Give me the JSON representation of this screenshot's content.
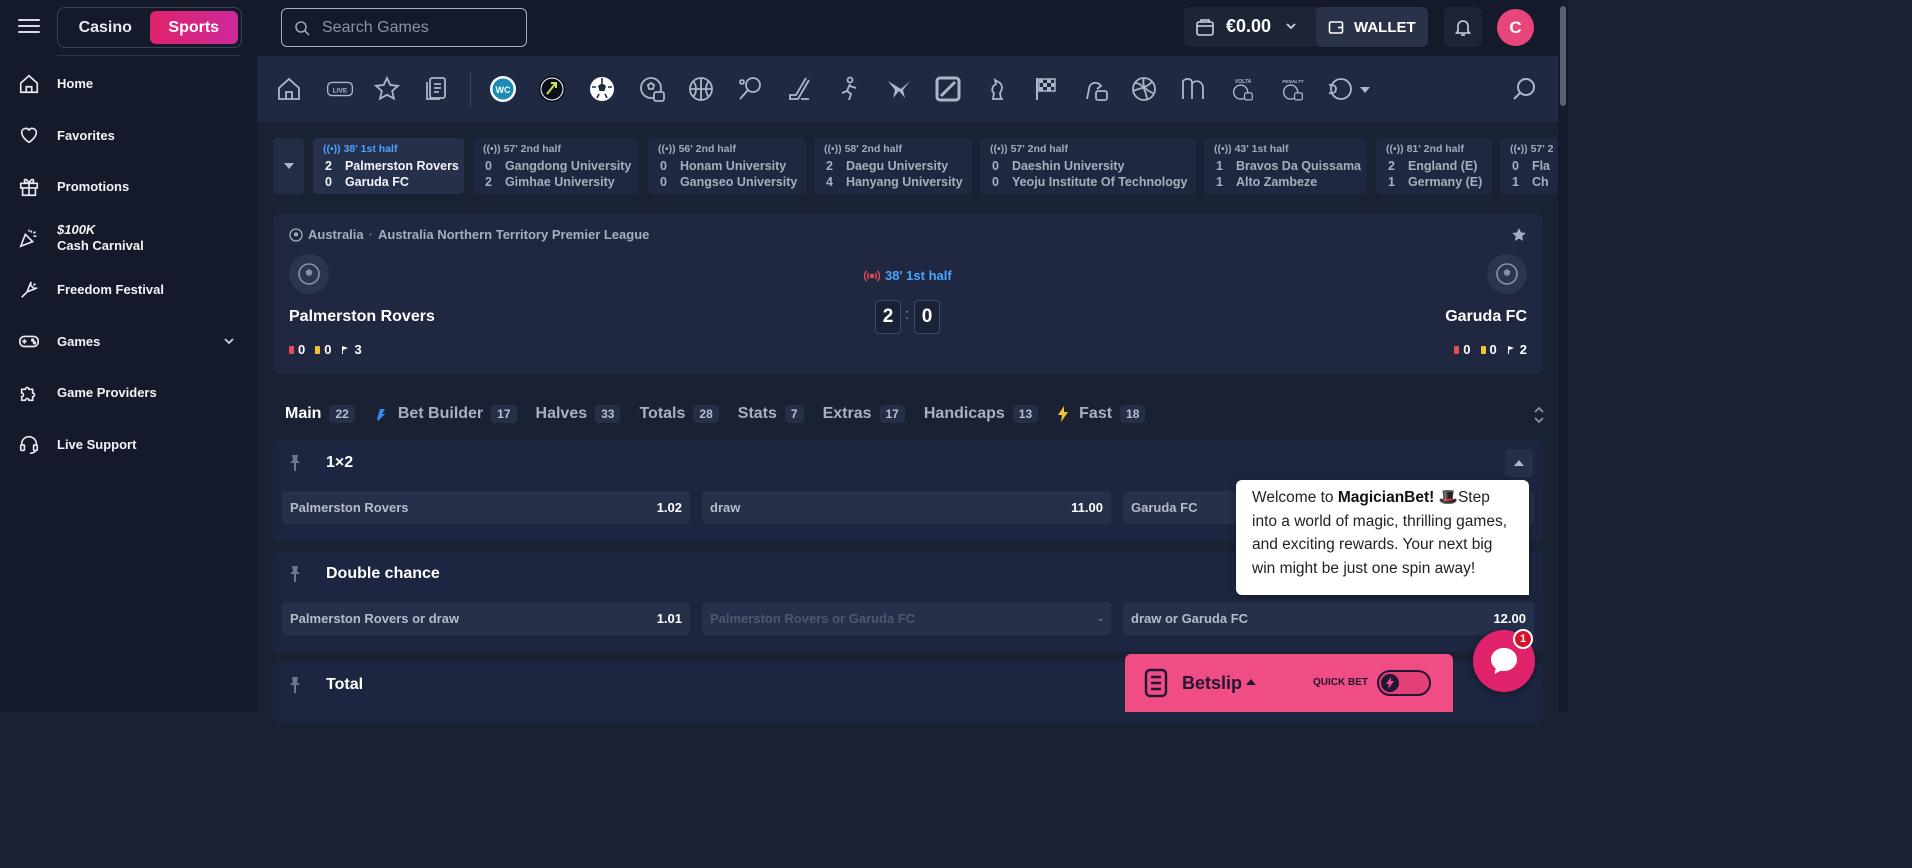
{
  "sidebar": {
    "toggle": {
      "casino": "Casino",
      "sports": "Sports"
    },
    "items": [
      {
        "label": "Home",
        "icon": "home-icon"
      },
      {
        "label": "Favorites",
        "icon": "heart-icon"
      },
      {
        "label": "Promotions",
        "icon": "gift-icon"
      },
      {
        "label_top": "$100K",
        "label": "Cash Carnival",
        "icon": "confetti-icon"
      },
      {
        "label": "Freedom Festival",
        "icon": "fireworks-icon"
      },
      {
        "label": "Games",
        "icon": "gamepad-icon"
      },
      {
        "label": "Game Providers",
        "icon": "puzzle-icon"
      },
      {
        "label": "Live Support",
        "icon": "headset-icon"
      }
    ]
  },
  "topbar": {
    "search_placeholder": "Search Games",
    "balance": "€0.00",
    "wallet_label": "WALLET",
    "avatar_letter": "C"
  },
  "sports_icons": [
    "home-icon",
    "live-icon",
    "star-icon",
    "betslip-history-icon",
    "world-cup-icon",
    "tennis-badge-icon",
    "soccer-icon",
    "efootball-icon",
    "basketball-icon",
    "tennis-icon",
    "ice-hockey-icon",
    "cricket-icon",
    "volleyball-icon",
    "table-tennis-icon",
    "chess-icon",
    "racing-flag-icon",
    "esports-icon",
    "volleyball-icon",
    "handball-icon",
    "volta-icon",
    "penalty-icon",
    "more-sports-icon",
    "search-icon"
  ],
  "sports_labels": {
    "volta": "VOLTA",
    "penalty": "PENALTY"
  },
  "live_matches": [
    {
      "time": "38' 1st half",
      "home": "Palmerston Rovers",
      "away": "Garuda FC",
      "hs": "2",
      "as": "0",
      "active": true
    },
    {
      "time": "57' 2nd half",
      "home": "Gangdong University",
      "away": "Gimhae University",
      "hs": "0",
      "as": "2"
    },
    {
      "time": "56' 2nd half",
      "home": "Honam University",
      "away": "Gangseo University",
      "hs": "0",
      "as": "0"
    },
    {
      "time": "58' 2nd half",
      "home": "Daegu University",
      "away": "Hanyang University",
      "hs": "2",
      "as": "4"
    },
    {
      "time": "57' 2nd half",
      "home": "Daeshin University",
      "away": "Yeoju Institute Of Technology",
      "hs": "0",
      "as": "0"
    },
    {
      "time": "43' 1st half",
      "home": "Bravos Da Quissama",
      "away": "Alto Zambeze",
      "hs": "1",
      "as": "1"
    },
    {
      "time": "81' 2nd half",
      "home": "England (E)",
      "away": "Germany (E)",
      "hs": "2",
      "as": "1"
    },
    {
      "time": "57' 2",
      "home": "Fla",
      "away": "Ch",
      "hs": "0",
      "as": "1"
    }
  ],
  "match": {
    "country": "Australia",
    "league": "Australia Northern Territory Premier League",
    "status": "38' 1st half",
    "home": "Palmerston Rovers",
    "away": "Garuda FC",
    "home_score": "2",
    "away_score": "0",
    "colon": ":",
    "home_stats": {
      "red": "0",
      "yellow": "0",
      "corners": "3"
    },
    "away_stats": {
      "red": "0",
      "yellow": "0",
      "corners": "2"
    }
  },
  "tabs": [
    {
      "label": "Main",
      "count": "22"
    },
    {
      "label": "Bet Builder",
      "count": "17"
    },
    {
      "label": "Halves",
      "count": "33"
    },
    {
      "label": "Totals",
      "count": "28"
    },
    {
      "label": "Stats",
      "count": "7"
    },
    {
      "label": "Extras",
      "count": "17"
    },
    {
      "label": "Handicaps",
      "count": "13"
    },
    {
      "label": "Fast",
      "count": "18"
    }
  ],
  "markets": [
    {
      "title": "1×2",
      "odds": [
        {
          "label": "Palmerston Rovers",
          "value": "1.02"
        },
        {
          "label": "draw",
          "value": "11.00"
        },
        {
          "label": "Garuda FC",
          "value": ""
        }
      ]
    },
    {
      "title": "Double chance",
      "odds": [
        {
          "label": "Palmerston Rovers or draw",
          "value": "1.01"
        },
        {
          "label": "Palmerston Rovers or Garuda FC",
          "value": "-"
        },
        {
          "label": "draw or Garuda FC",
          "value": "12.00"
        }
      ]
    },
    {
      "title": "Total"
    }
  ],
  "chat": {
    "pre": "Welcome to ",
    "brand": "MagicianBet!",
    "hat": "🎩",
    "rest": "Step into a world of magic, thrilling games, and exciting rewards. Your next big win might be just one spin away!",
    "badge": "1"
  },
  "betslip": {
    "label": "Betslip",
    "quick_bet": "QUICK BET"
  },
  "colors": {
    "accent": "#e0226a",
    "live_blue": "#4aa3ff",
    "betslip": "#f04d85",
    "bg": "#1a2133"
  }
}
